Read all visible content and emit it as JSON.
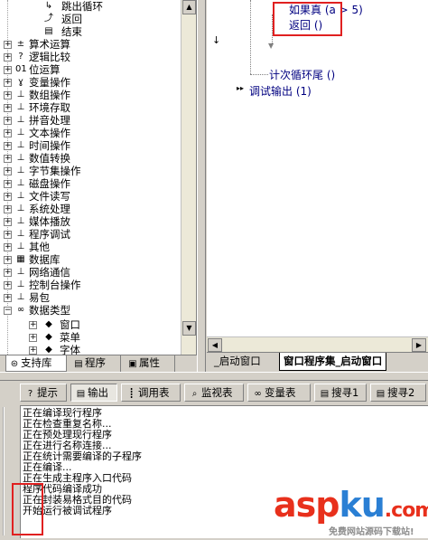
{
  "tree": {
    "top_items": [
      {
        "label": "跳出循环",
        "icon": "jump-out-icon"
      },
      {
        "label": "返回",
        "icon": "return-icon"
      },
      {
        "label": "结束",
        "icon": "end-icon"
      }
    ],
    "items": [
      {
        "label": "算术运算",
        "icon": "arithmetic-icon",
        "glyph": "±"
      },
      {
        "label": "逻辑比较",
        "icon": "question-icon",
        "glyph": "?"
      },
      {
        "label": "位运算",
        "icon": "bitwise-icon",
        "glyph": "01"
      },
      {
        "label": "变量操作",
        "icon": "variable-icon",
        "glyph": "ɣ"
      },
      {
        "label": "数组操作",
        "icon": "library-icon",
        "glyph": "⊥"
      },
      {
        "label": "环境存取",
        "icon": "library-icon",
        "glyph": "⊥"
      },
      {
        "label": "拼音处理",
        "icon": "library-icon",
        "glyph": "⊥"
      },
      {
        "label": "文本操作",
        "icon": "library-icon",
        "glyph": "⊥"
      },
      {
        "label": "时间操作",
        "icon": "library-icon",
        "glyph": "⊥"
      },
      {
        "label": "数值转换",
        "icon": "library-icon",
        "glyph": "⊥"
      },
      {
        "label": "字节集操作",
        "icon": "library-icon",
        "glyph": "⊥"
      },
      {
        "label": "磁盘操作",
        "icon": "library-icon",
        "glyph": "⊥"
      },
      {
        "label": "文件读写",
        "icon": "library-icon",
        "glyph": "⊥"
      },
      {
        "label": "系统处理",
        "icon": "library-icon",
        "glyph": "⊥"
      },
      {
        "label": "媒体播放",
        "icon": "library-icon",
        "glyph": "⊥"
      },
      {
        "label": "程序调试",
        "icon": "library-icon",
        "glyph": "⊥"
      },
      {
        "label": "其他",
        "icon": "library-icon",
        "glyph": "⊥"
      },
      {
        "label": "数据库",
        "icon": "database-icon",
        "glyph": "▦"
      },
      {
        "label": "网络通信",
        "icon": "library-icon",
        "glyph": "⊥"
      },
      {
        "label": "控制台操作",
        "icon": "library-icon",
        "glyph": "⊥"
      },
      {
        "label": "易包",
        "icon": "library-icon",
        "glyph": "⊥"
      },
      {
        "label": "数据类型",
        "icon": "datatype-icon",
        "glyph": "∞"
      }
    ],
    "sub_items": [
      {
        "label": "窗口",
        "icon": "diamond-icon"
      },
      {
        "label": "菜单",
        "icon": "diamond-icon"
      },
      {
        "label": "字体",
        "icon": "diamond-icon"
      }
    ]
  },
  "left_tabs": [
    {
      "label": "支持库",
      "icon": "support-lib-icon",
      "glyph": "⊜"
    },
    {
      "label": "程序",
      "icon": "program-icon",
      "glyph": "▤"
    },
    {
      "label": "属性",
      "icon": "property-icon",
      "glyph": "▣"
    }
  ],
  "editor": {
    "line_if": "如果真 (a > 5)",
    "line_return": "返回 ()",
    "line_loop_end": "计次循环尾 ()",
    "line_debug": "调试输出 (1)"
  },
  "editor_tabs": [
    {
      "label": "_启动窗口"
    },
    {
      "label": "窗口程序集_启动窗口"
    }
  ],
  "output_tabs": [
    {
      "label": "提示",
      "icon": "hint-icon",
      "glyph": "?"
    },
    {
      "label": "输出",
      "icon": "output-icon",
      "glyph": "▤"
    },
    {
      "label": "调用表",
      "icon": "call-table-icon",
      "glyph": "┋"
    },
    {
      "label": "监视表",
      "icon": "watch-icon",
      "glyph": "⌕"
    },
    {
      "label": "变量表",
      "icon": "variable-table-icon",
      "glyph": "∞"
    },
    {
      "label": "搜寻1",
      "icon": "search1-icon",
      "glyph": "▤"
    },
    {
      "label": "搜寻2",
      "icon": "search2-icon",
      "glyph": "▤"
    }
  ],
  "output_lines": [
    "正在编译现行程序",
    "正在检查重复名称...",
    "正在预处理现行程序",
    "正在进行名称连接...",
    "正在统计需要编译的子程序",
    "正在编译...",
    "正在生成主程序入口代码",
    "程序代码编译成功",
    "正在封装易格式目的代码",
    "开始运行被调试程序"
  ],
  "watermark": {
    "logo_a": "asp",
    "logo_b": "ku",
    "logo_c": ".com",
    "subtitle": "免费网站源码下载站!"
  },
  "colors": {
    "highlight": "#e02020",
    "logo_red": "#e8301c",
    "logo_blue": "#2a7fd4"
  }
}
